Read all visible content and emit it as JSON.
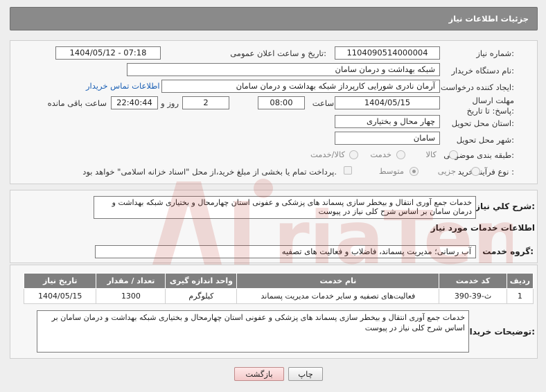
{
  "header": {
    "title": "جزئیات اطلاعات نیاز"
  },
  "form": {
    "need_number_label": "شماره نیاز:",
    "need_number": "1104090514000004",
    "announce_label": "تاریخ و ساعت اعلان عمومی:",
    "announce_value": "1404/05/12 - 07:18",
    "buyer_org_label": "نام دستگاه خریدار:",
    "buyer_org": "شبکه بهداشت و درمان سامان",
    "requester_label": "ایجاد کننده درخواست:",
    "requester": "آرمان نادری شورایی کارپرداز شبکه بهداشت و درمان سامان",
    "contact_link": "اطلاعات تماس خریدار",
    "deadline_label": "مهلت ارسال پاسخ: تا تاریخ:",
    "deadline_date": "1404/05/15",
    "time_label": "ساعت",
    "deadline_time": "08:00",
    "days_value": "2",
    "days_label": "روز و",
    "remaining_time": "22:40:44",
    "remaining_label": "ساعت باقی مانده",
    "province_label": "استان محل تحویل:",
    "province": "چهار محال و بختیاری",
    "city_label": "شهر محل تحویل:",
    "city": "سامان",
    "category_label": "طبقه بندی موضوعی:",
    "category_options": [
      "کالا",
      "خدمت",
      "کالا/خدمت"
    ],
    "process_label": "نوع فرآیند خرید :",
    "process_options": [
      "جزیی",
      "متوسط"
    ],
    "payment_note": "پرداخت تمام یا بخشی از مبلغ خرید،از محل \"اسناد خزانه اسلامی\" خواهد بود."
  },
  "summary": {
    "label": "شرح کلي نياز:",
    "text": "خدمات جمع آوری انتقال و بیخطر سازی پسماند های پزشکی و عفونی استان چهارمحال و بختیاری شبکه بهداشت و درمان سامان بر اساس شرح کلی نیاز در پیوست"
  },
  "services": {
    "section_title": "اطلاعات خدمات مورد نیاز",
    "group_label": "گروه خدمت:",
    "group_value": "آب رسانی؛ مدیریت پسماند، فاضلاب و فعالیت های تصفیه",
    "columns": [
      "ردیف",
      "کد خدمت",
      "نام خدمت",
      "واحد اندازه گیری",
      "تعداد / مقدار",
      "تاریخ نیاز"
    ],
    "rows": [
      [
        "1",
        "ث-39-390",
        "فعالیت‌های تصفیه و سایر خدمات مدیریت پسماند",
        "کیلوگرم",
        "1300",
        "1404/05/15"
      ]
    ]
  },
  "buyer_notes": {
    "label": "توضیحات خریدار:",
    "text": "خدمات جمع آوری انتقال و بیخطر سازی پسماند های پزشکی و عفونی استان چهارمحال و بختیاری شبکه بهداشت و درمان سامان بر اساس شرح کلی نیاز در پیوست"
  },
  "buttons": {
    "print": "چاپ",
    "back": "بازگشت"
  },
  "colors": {
    "header_bg": "#8a8a8a",
    "table_header_bg": "#7f7f7f",
    "link": "#1a5fb4",
    "watermark": "#c0392b"
  },
  "watermark": {
    "text": "AriaTender.neT"
  }
}
